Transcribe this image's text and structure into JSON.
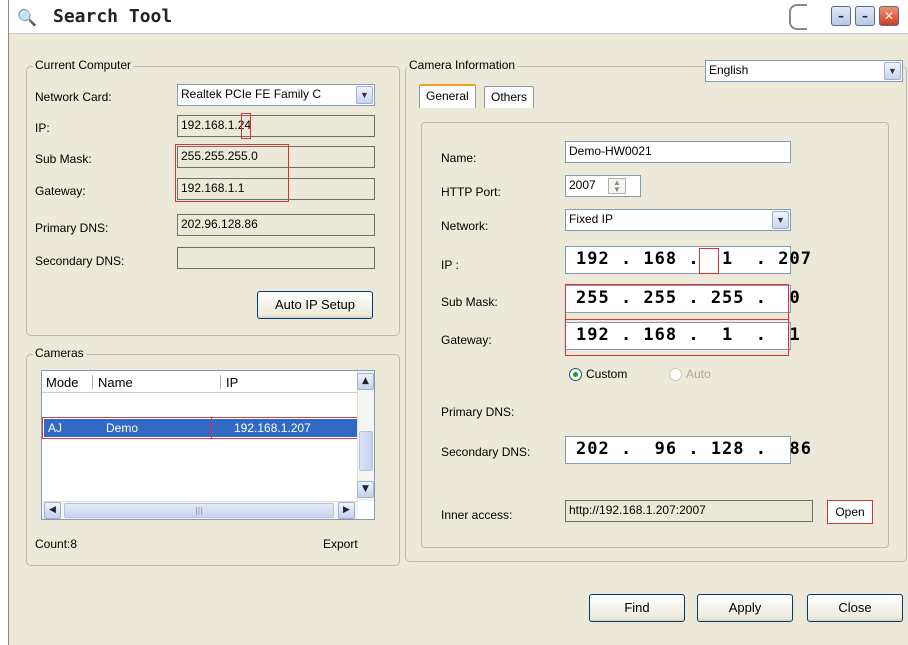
{
  "window": {
    "title": "Search Tool",
    "title_icon": "magnifier-folder-icon"
  },
  "current_computer": {
    "legend": "Current Computer",
    "network_card_label": "Network Card:",
    "network_card_value": "Realtek PCIe FE Family C",
    "ip_label": "IP:",
    "ip_value": "192.168.1.24",
    "submask_label": "Sub Mask:",
    "submask_value": "255.255.255.0",
    "gateway_label": "Gateway:",
    "gateway_value": "192.168.1.1",
    "pdns_label": "Primary DNS:",
    "pdns_value": "202.96.128.86",
    "sdns_label": "Secondary DNS:",
    "sdns_value": "",
    "auto_ip_button": "Auto IP Setup"
  },
  "cameras": {
    "legend": "Cameras",
    "columns": [
      "Mode",
      "Name",
      "IP"
    ],
    "rows": [
      {
        "mode": "AJ",
        "name": "Demo",
        "ip": "192.168.1.207"
      }
    ],
    "count_label": "Count:8",
    "export_label": "Export"
  },
  "camera_info": {
    "legend": "Camera Information",
    "language": "English",
    "tabs": [
      "General",
      "Others"
    ],
    "name_label": "Name:",
    "name_value": "Demo-HW0021",
    "http_port_label": "HTTP Port:",
    "http_port_value": "2007",
    "network_label": "Network:",
    "network_value": "Fixed IP",
    "ip_label": "IP :",
    "ip_value": "192 . 168 .  1  . 207",
    "submask_label": "Sub Mask:",
    "submask_value": "255 . 255 . 255 .  0",
    "gateway_label": "Gateway:",
    "gateway_value": "192 . 168 .  1  .  1",
    "custom_label": "Custom",
    "auto_label": "Auto",
    "pdns_label": "Primary DNS:",
    "sdns_label": "Secondary DNS:",
    "sdns_value": "202 .  96 . 128 .  86",
    "inner_access_label": "Inner access:",
    "inner_access_value": "http://192.168.1.207:2007",
    "open_button": "Open"
  },
  "buttons": {
    "find": "Find",
    "apply": "Apply",
    "close": "Close"
  },
  "colors": {
    "accent_red": "#e03030",
    "selection_blue": "#316ac5",
    "window_bg": "#ece9d8"
  }
}
